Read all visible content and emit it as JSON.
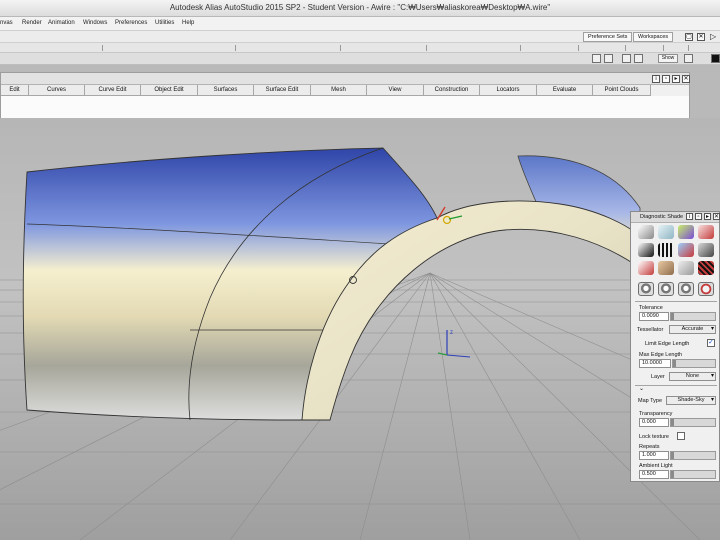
{
  "window": {
    "title": "Autodesk Alias AutoStudio 2015 SP2 - Student Version  - Awire : \"C:₩Users₩aliaskorea₩Desktop₩A.wire\""
  },
  "menu": {
    "items": [
      "nvas",
      "Render",
      "Animation",
      "Windows",
      "Preferences",
      "Utilities",
      "Help"
    ]
  },
  "toolbar": {
    "preference_sets": "Preference Sets",
    "workspaces": "Workspaces",
    "show": "Show"
  },
  "palette": {
    "tabs": [
      "Edit",
      "Curves",
      "Curve Edit",
      "Object Edit",
      "Surfaces",
      "Surface Edit",
      "Mesh",
      "View",
      "Construction",
      "Locators",
      "Evaluate",
      "Point Clouds"
    ]
  },
  "viewport": {
    "axis_label": "z"
  },
  "diagnostic": {
    "title": "Diagnostic Shade",
    "tolerance_label": "Tolerance",
    "tolerance_value": "0.0090",
    "tessellator_label": "Tessellator",
    "tessellator_value": "Accurate",
    "limit_edge_label": "Limit Edge Length",
    "limit_edge_checked": "✓",
    "max_edge_label": "Max Edge Length",
    "max_edge_value": "10.0000",
    "layer_label": "Layer",
    "layer_value": "None",
    "map_type_label": "Map Type",
    "map_type_value": "Shade-Sky",
    "transparency_label": "Transparency",
    "transparency_value": "0.000",
    "lock_texture_label": "Lock texture",
    "repeats_label": "Repeats",
    "repeats_value": "1.000",
    "ambient_label": "Ambient Light",
    "ambient_value": "0.500"
  },
  "colors": {
    "viewport_bg": "#b9b9b9",
    "surface_blue": "#5b78c8",
    "surface_cream": "#efe7c2",
    "manipulator_red": "#d23a2a",
    "axis_blue": "#2c3fb8",
    "axis_green": "#2c9b3c"
  }
}
